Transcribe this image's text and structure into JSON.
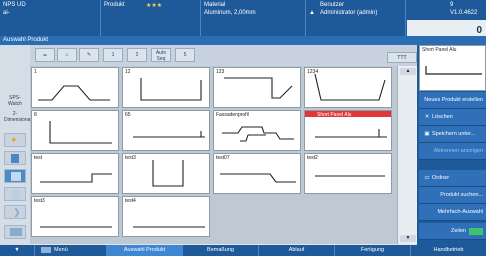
{
  "header": {
    "app_label": "NPS UD",
    "app_sub": "ai-",
    "product_label": "Produkt",
    "stars": "★★★",
    "material_label": "Material",
    "material_value": "Aluminum, 2,00mm",
    "user_label": "Benutzer",
    "user_value": "Administrator (admin)",
    "version": "V1.0.4622",
    "count": "9",
    "page_value": "0"
  },
  "title_bar": "Auswahl Produkt",
  "left_rail": {
    "sps_label": "SPS-Watch",
    "view_label": "2-Dimensional"
  },
  "toolbar": {
    "btn1": "1",
    "btn2": "2",
    "auto_seq": "Auto Seq",
    "btn5": "5",
    "ttt_label": "TTT"
  },
  "grid": {
    "cells": [
      {
        "label": "1"
      },
      {
        "label": "12"
      },
      {
        "label": "123"
      },
      {
        "label": "1234"
      },
      {
        "label": "8"
      },
      {
        "label": "65"
      },
      {
        "label": "Fassadenprofil"
      },
      {
        "label": "Short Panel Alu"
      },
      {
        "label": "test"
      },
      {
        "label": "test3"
      },
      {
        "label": "test07"
      },
      {
        "label": "test2"
      },
      {
        "label": "test3"
      },
      {
        "label": "test4"
      }
    ]
  },
  "right_panel": {
    "preview_label": "Short Panel Alu",
    "new_product": "Neues Produkt erstellen",
    "delete": "Löschen",
    "save_as": "Speichern unter...",
    "revise": "Abtrennen anzeigen",
    "folder": "Ordner",
    "search": "Produkt suchen...",
    "multi_select": "Mehrfach-Auswahl",
    "rows_label": "Zeilen"
  },
  "bottom_tabs": {
    "menu": "Menü",
    "select_product": "Auswahl Produkt",
    "dimension": "Bemaßung",
    "flow": "Ablauf",
    "production": "Fertigung",
    "manual": "Handbetrieb"
  },
  "colors": {
    "accent": "#1e5a9a",
    "selected": "#e33636",
    "active_tab": "#3d86d1"
  }
}
